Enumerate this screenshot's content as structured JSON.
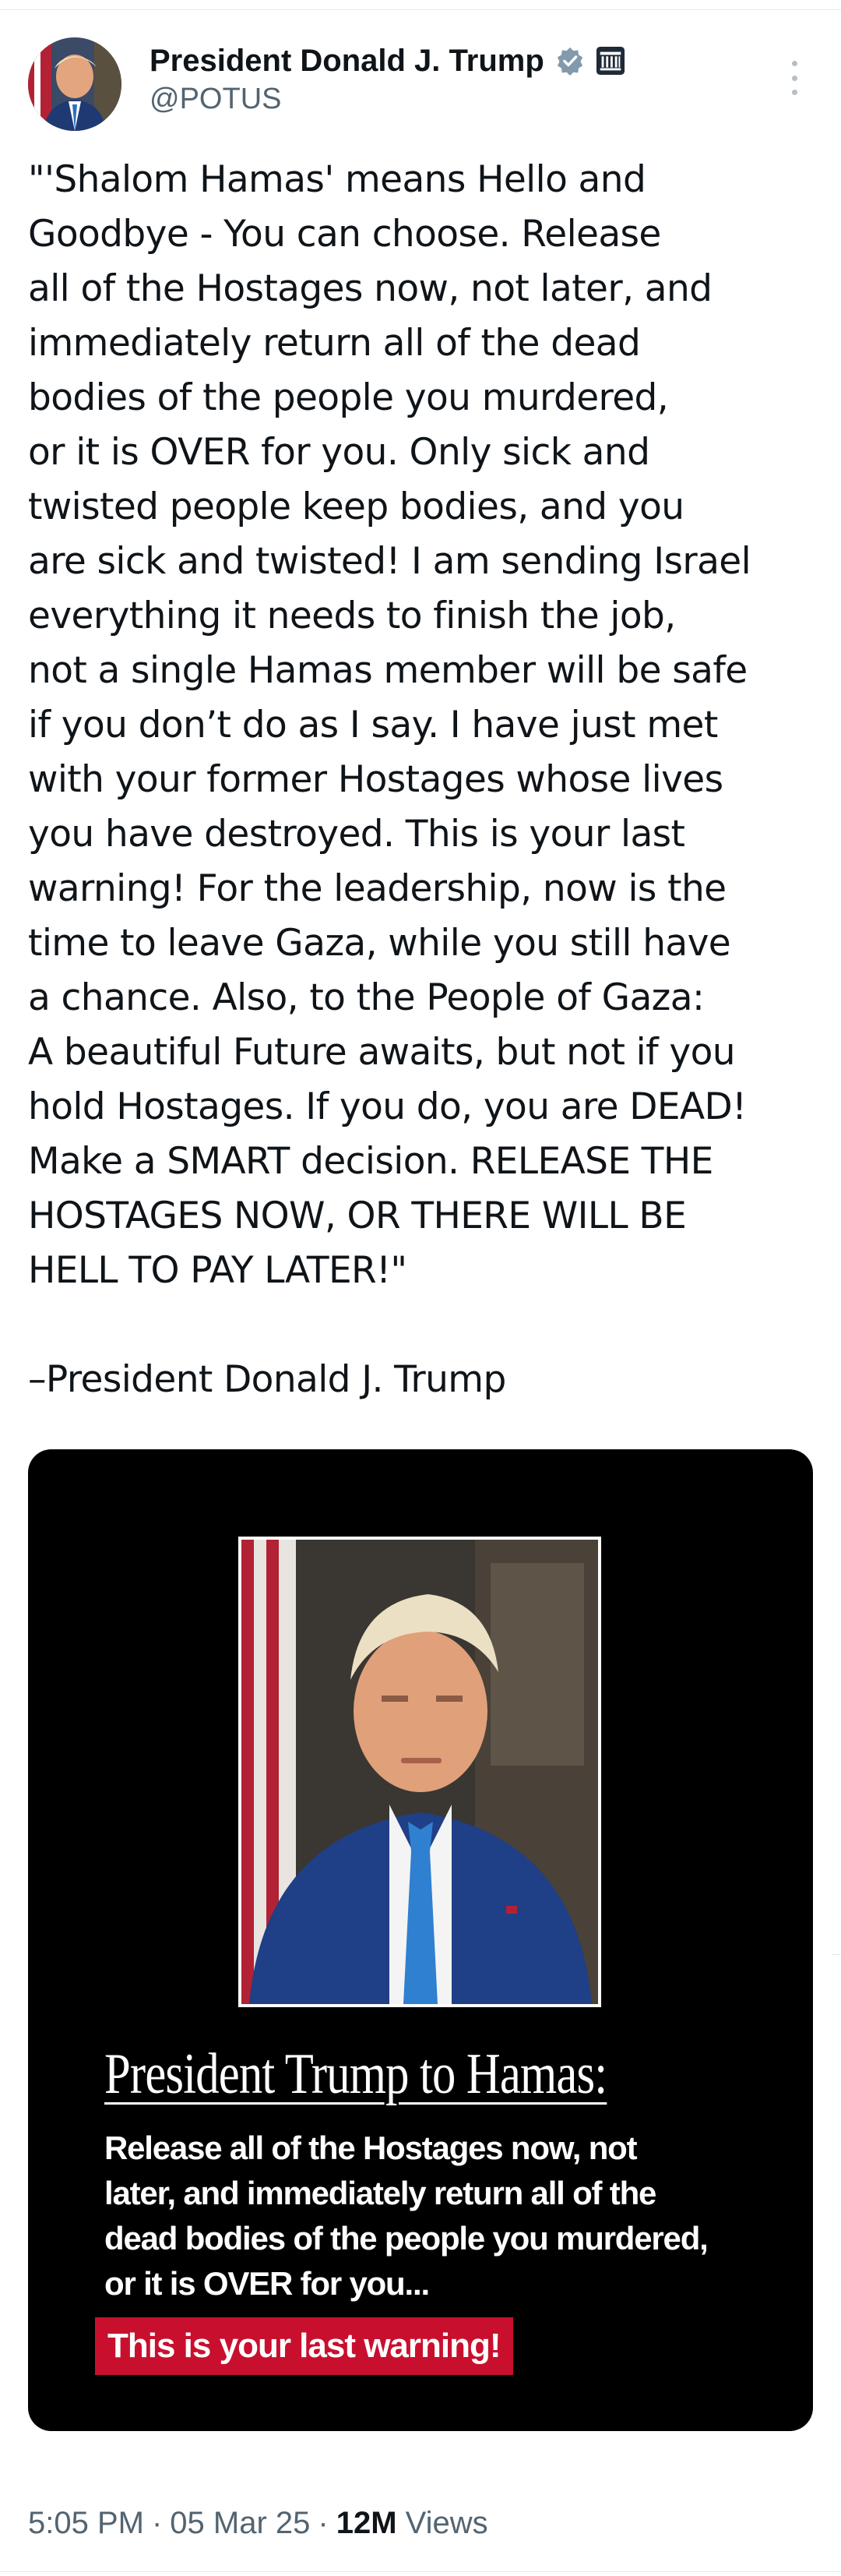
{
  "author": {
    "display_name": "President Donald J. Trump",
    "handle": "@POTUS",
    "verified_icon": "verified-badge-icon",
    "affiliation_icon": "government-building-icon",
    "avatar_icon": "avatar"
  },
  "more_icon": "more-options-icon",
  "tweet": {
    "text": "\"'Shalom Hamas' means Hello and\nGoodbye - You can choose. Release\nall of the Hostages now, not later, and\nimmediately return all of the dead\nbodies of the people you murdered,\nor it is OVER for you. Only sick and\ntwisted people keep bodies, and you\nare sick and twisted! I am sending Israel\neverything it needs to finish the job,\nnot a single Hamas member will be safe\nif you don’t do as I say. I have just met\nwith your former Hostages whose lives\nyou have destroyed. This is your last\nwarning! For the leadership, now is the\ntime to leave Gaza, while you still have\na chance. Also, to the People of Gaza:\nA beautiful Future awaits, but not if you\nhold Hostages. If you do, you are DEAD!\nMake a SMART decision. RELEASE THE\nHOSTAGES NOW, OR THERE WILL BE\nHELL TO PAY LATER!\"",
    "signature": "–President Donald J. Trump"
  },
  "media": {
    "headline": "President Trump to Hamas:",
    "body": "Release all of the Hostages now, not\nlater, and immediately return all of the\ndead bodies of the people you murdered,\nor it is OVER for you...",
    "warning": "This is your last warning!",
    "background_color": "#000000",
    "warning_color": "#c8102e"
  },
  "meta": {
    "time": "5:05 PM",
    "date": "05 Mar 25",
    "separator": "·",
    "views_count": "12M",
    "views_label": "Views"
  },
  "colors": {
    "text": "#0f1419",
    "secondary": "#536471",
    "verified": "#829aab"
  }
}
